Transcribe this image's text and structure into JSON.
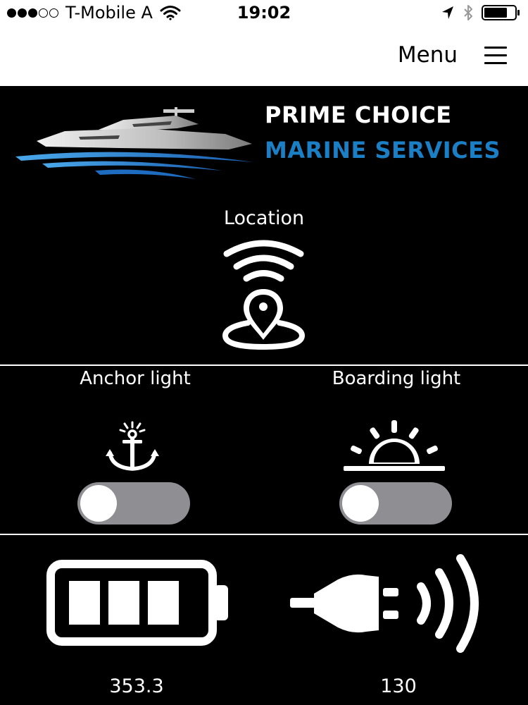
{
  "status_bar": {
    "signal": [
      true,
      true,
      true,
      false,
      false
    ],
    "carrier": "T-Mobile A",
    "time": "19:02"
  },
  "nav": {
    "menu_label": "Menu"
  },
  "brand": {
    "line1": "PRIME CHOICE",
    "line2": "MARINE SERVICES",
    "accent_color": "#1a7fc4"
  },
  "location": {
    "title": "Location"
  },
  "lights": {
    "anchor": {
      "label": "Anchor light",
      "on": false
    },
    "boarding": {
      "label": "Boarding light",
      "on": false
    }
  },
  "readings": {
    "battery": "353.3",
    "shore_power": "130"
  },
  "icons": [
    "wifi-icon",
    "location-arrow-icon",
    "bluetooth-icon",
    "battery-status-icon",
    "hamburger-icon",
    "boat-logo-icon",
    "location-pin-signal-icon",
    "anchor-light-icon",
    "boarding-light-icon",
    "battery-icon",
    "shore-power-plug-icon"
  ]
}
